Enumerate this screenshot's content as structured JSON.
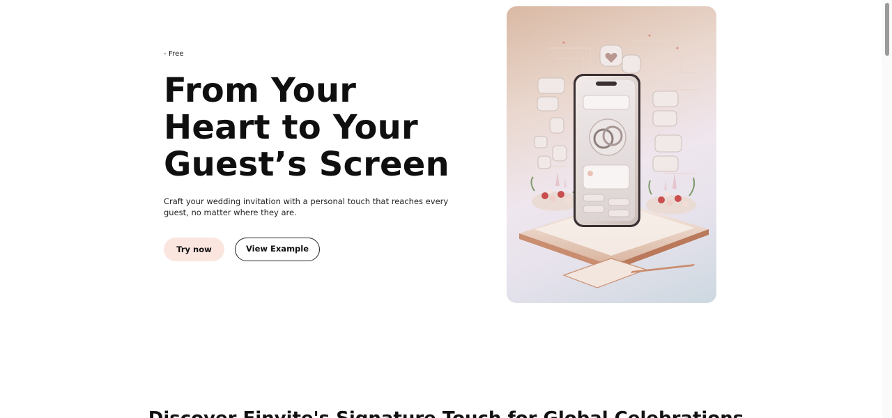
{
  "hero": {
    "eyebrow": "- Free",
    "headline_lines": [
      "From Your",
      "Heart to Your",
      "Guest’s Screen"
    ],
    "subtext": "Craft your wedding invitation with a personal touch that reaches every guest, no matter where they are.",
    "primary_button": "Try now",
    "secondary_button": "View Example",
    "primary_button_color": "#fbe6df"
  },
  "section": {
    "title": "Discover Einvite's Signature Touch for Global Celebrations"
  },
  "image": {
    "icon": "wedding-phone-illustration"
  }
}
